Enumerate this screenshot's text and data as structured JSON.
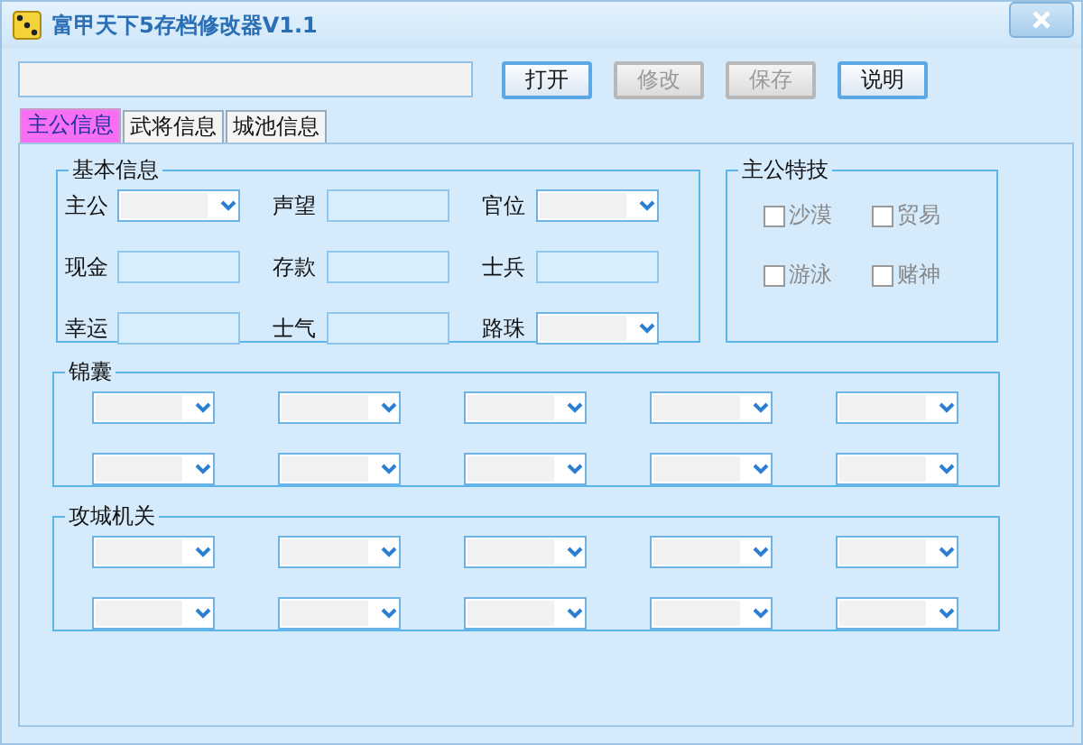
{
  "window": {
    "title": "富甲天下5存档修改器V1.1"
  },
  "toolbar": {
    "buttons": [
      {
        "label": "打开",
        "disabled": false
      },
      {
        "label": "修改",
        "disabled": true
      },
      {
        "label": "保存",
        "disabled": true
      },
      {
        "label": "说明",
        "disabled": false
      }
    ]
  },
  "tabs": [
    {
      "label": "主公信息",
      "selected": true
    },
    {
      "label": "武将信息",
      "selected": false
    },
    {
      "label": "城池信息",
      "selected": false
    }
  ],
  "basic_info": {
    "title": "基本信息",
    "fields": [
      {
        "label": "主公",
        "kind": "combo"
      },
      {
        "label": "声望",
        "kind": "text"
      },
      {
        "label": "官位",
        "kind": "combo"
      },
      {
        "label": "现金",
        "kind": "text"
      },
      {
        "label": "存款",
        "kind": "text"
      },
      {
        "label": "士兵",
        "kind": "text"
      },
      {
        "label": "幸运",
        "kind": "text"
      },
      {
        "label": "士气",
        "kind": "text"
      },
      {
        "label": "路珠",
        "kind": "combo"
      }
    ]
  },
  "lord_skills": {
    "title": "主公特技",
    "items": [
      {
        "label": "沙漠",
        "checked": false,
        "disabled": true
      },
      {
        "label": "贸易",
        "checked": false,
        "disabled": true
      },
      {
        "label": "游泳",
        "checked": false,
        "disabled": true
      },
      {
        "label": "赌神",
        "checked": false,
        "disabled": true
      }
    ]
  },
  "tips_group": {
    "title": "锦囊",
    "dropdowns": [
      {
        "kind": "combo"
      },
      {
        "kind": "combo"
      },
      {
        "kind": "combo"
      },
      {
        "kind": "combo"
      },
      {
        "kind": "combo"
      },
      {
        "kind": "combo"
      },
      {
        "kind": "combo"
      },
      {
        "kind": "combo"
      },
      {
        "kind": "combo"
      },
      {
        "kind": "combo"
      }
    ]
  },
  "siege_group": {
    "title": "攻城机关",
    "dropdowns": [
      {
        "kind": "combo"
      },
      {
        "kind": "combo"
      },
      {
        "kind": "combo"
      },
      {
        "kind": "combo"
      },
      {
        "kind": "combo"
      },
      {
        "kind": "combo"
      },
      {
        "kind": "combo"
      },
      {
        "kind": "combo"
      },
      {
        "kind": "combo"
      },
      {
        "kind": "combo"
      }
    ]
  }
}
